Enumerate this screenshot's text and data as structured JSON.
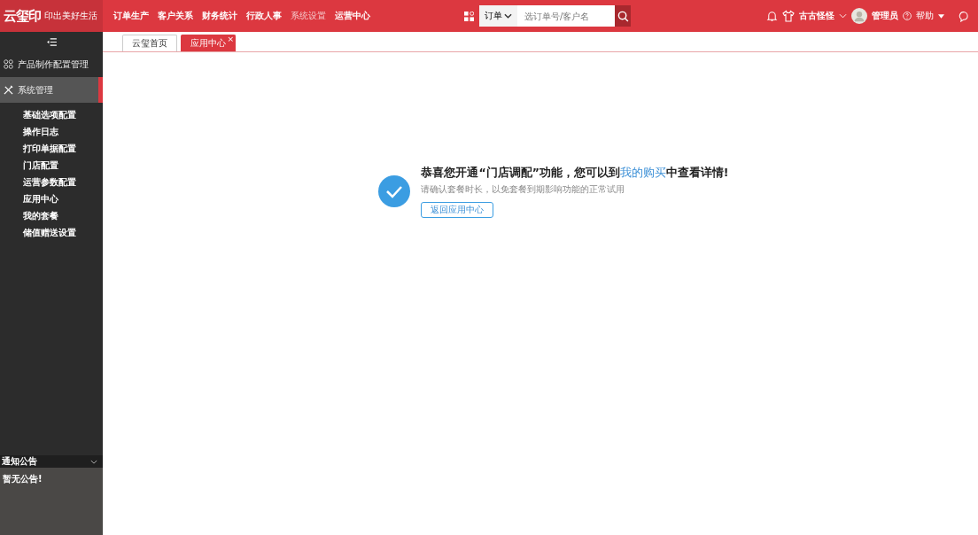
{
  "header": {
    "logo": {
      "mark": "云玺印",
      "slogan": "印出美好生活"
    },
    "nav": [
      {
        "label": "订单生产",
        "selected": false
      },
      {
        "label": "客户关系",
        "selected": false
      },
      {
        "label": "财务统计",
        "selected": false
      },
      {
        "label": "行政人事",
        "selected": false
      },
      {
        "label": "系统设置",
        "selected": true
      },
      {
        "label": "运营中心",
        "selected": false
      }
    ],
    "search": {
      "type": "订单",
      "placeholder": "选订单号/客户名"
    },
    "shop": "古古怪怪",
    "user": "管理员",
    "help": "帮助"
  },
  "sidebar": {
    "groups": [
      {
        "label": "产品制作配置管理",
        "selected": false
      },
      {
        "label": "系统管理",
        "selected": true,
        "children": [
          {
            "label": "基础选项配置"
          },
          {
            "label": "操作日志"
          },
          {
            "label": "打印单据配置"
          },
          {
            "label": "门店配置"
          },
          {
            "label": "运营参数配置"
          },
          {
            "label": "应用中心"
          },
          {
            "label": "我的套餐"
          },
          {
            "label": "储值赠送设置"
          }
        ]
      }
    ],
    "notice": {
      "title": "通知公告",
      "text": "暂无公告!"
    }
  },
  "tabs": [
    {
      "label": "云玺首页",
      "selected": false,
      "closable": false
    },
    {
      "label": "应用中心",
      "selected": true,
      "closable": true
    }
  ],
  "tab_close": "×",
  "message": {
    "title_before": "恭喜您开通“门店调配”功能，您可以到",
    "title_link": "我的购买",
    "title_after": "中查看详情!",
    "subtitle": "请确认套餐时长，以免套餐到期影响功能的正常试用",
    "button": "返回应用中心"
  }
}
